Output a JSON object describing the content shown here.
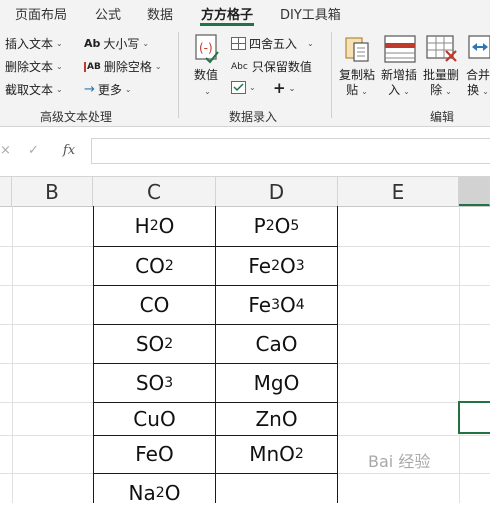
{
  "tabs": [
    {
      "label": "页面布局"
    },
    {
      "label": "公式"
    },
    {
      "label": "数据"
    },
    {
      "label": "方方格子",
      "active": true
    },
    {
      "label": "DIY工具箱"
    }
  ],
  "ribbon": {
    "text_group": {
      "items": [
        "插入文本",
        "删除文本",
        "截取文本"
      ],
      "case_label": "大小写",
      "case_icon_text": "Ab",
      "delete_space_label": "删除空格",
      "delete_space_icon_text": "AB",
      "more_label": "更多",
      "group_label": "高级文本处理"
    },
    "data_group": {
      "value_label": "数值",
      "round_label": "四舍五入",
      "keep_value_label": "只保留数值",
      "keep_value_icon_text": "Abc",
      "plus_label": "+",
      "group_label": "数据录入"
    },
    "edit_group": {
      "copy_paste_label_1": "复制粘",
      "copy_paste_label_2": "贴",
      "insert_label_1": "新增插",
      "insert_label_2": "入",
      "batch_delete_label_1": "批量删",
      "batch_delete_label_2": "除",
      "merge_label_1": "合并",
      "merge_label_2": "换",
      "group_label": "编辑"
    }
  },
  "formula_bar": {
    "cancel_icon_text": "×",
    "confirm_icon_text": "✓",
    "fx_label": "fx",
    "value": ""
  },
  "columns": [
    "B",
    "C",
    "D",
    "E"
  ],
  "rows": [
    {
      "c": [
        [
          "H",
          ""
        ],
        [
          "2",
          "sub"
        ],
        [
          "O",
          ""
        ]
      ],
      "d": [
        [
          "P",
          ""
        ],
        [
          "2",
          "sub"
        ],
        [
          "O",
          ""
        ],
        [
          "5",
          "sub"
        ]
      ]
    },
    {
      "c": [
        [
          "CO",
          ""
        ],
        [
          "2",
          "sub"
        ]
      ],
      "d": [
        [
          "Fe",
          ""
        ],
        [
          "2",
          "sub"
        ],
        [
          "O",
          ""
        ],
        [
          "3",
          "sub"
        ]
      ]
    },
    {
      "c": [
        [
          "CO",
          ""
        ]
      ],
      "d": [
        [
          "Fe",
          ""
        ],
        [
          "3",
          "sub"
        ],
        [
          "O",
          ""
        ],
        [
          "4",
          "sub"
        ]
      ]
    },
    {
      "c": [
        [
          "SO",
          ""
        ],
        [
          "2",
          "sub"
        ]
      ],
      "d": [
        [
          "CaO",
          ""
        ]
      ]
    },
    {
      "c": [
        [
          "SO",
          ""
        ],
        [
          "3",
          "sub"
        ]
      ],
      "d": [
        [
          "MgO",
          ""
        ]
      ]
    },
    {
      "c": [
        [
          "CuO",
          ""
        ]
      ],
      "d": [
        [
          "ZnO",
          ""
        ]
      ]
    },
    {
      "c": [
        [
          "FeO",
          ""
        ]
      ],
      "d": [
        [
          "MnO",
          ""
        ],
        [
          "2",
          "sub"
        ]
      ]
    },
    {
      "c": [
        [
          "Na",
          ""
        ],
        [
          "2",
          "sub"
        ],
        [
          "O",
          ""
        ]
      ],
      "d": []
    }
  ],
  "watermark": "Bai 经验",
  "colors": {
    "accent": "#217346",
    "ribbon_bg": "#f3f3f3"
  }
}
